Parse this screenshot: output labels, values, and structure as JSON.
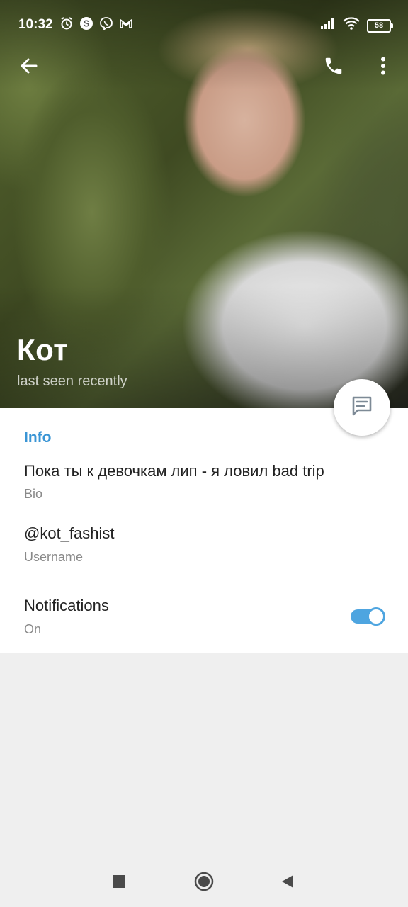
{
  "status_bar": {
    "time": "10:32",
    "battery": "58",
    "left_icons": [
      "alarm-icon",
      "skype-icon",
      "viber-icon",
      "gmail-icon"
    ],
    "right_icons": [
      "signal-icon",
      "wifi-icon",
      "battery-icon"
    ]
  },
  "profile": {
    "name": "Кот",
    "status": "last seen recently"
  },
  "actions": [
    "back-arrow-icon",
    "phone-icon",
    "more-vert-icon",
    "message-icon"
  ],
  "info": {
    "section_title": "Info",
    "bio_value": "Пока ты к девочкам лип - я ловил bad trip",
    "bio_label": "Bio",
    "username_value": "@kot_fashist",
    "username_label": "Username",
    "notifications_value": "Notifications",
    "notifications_label": "On",
    "notifications_enabled": true
  },
  "colors": {
    "accent": "#3a95d5",
    "toggle": "#4ea5e0",
    "background": "#efefef"
  },
  "nav": [
    "recent-apps-icon",
    "home-icon",
    "back-icon"
  ]
}
